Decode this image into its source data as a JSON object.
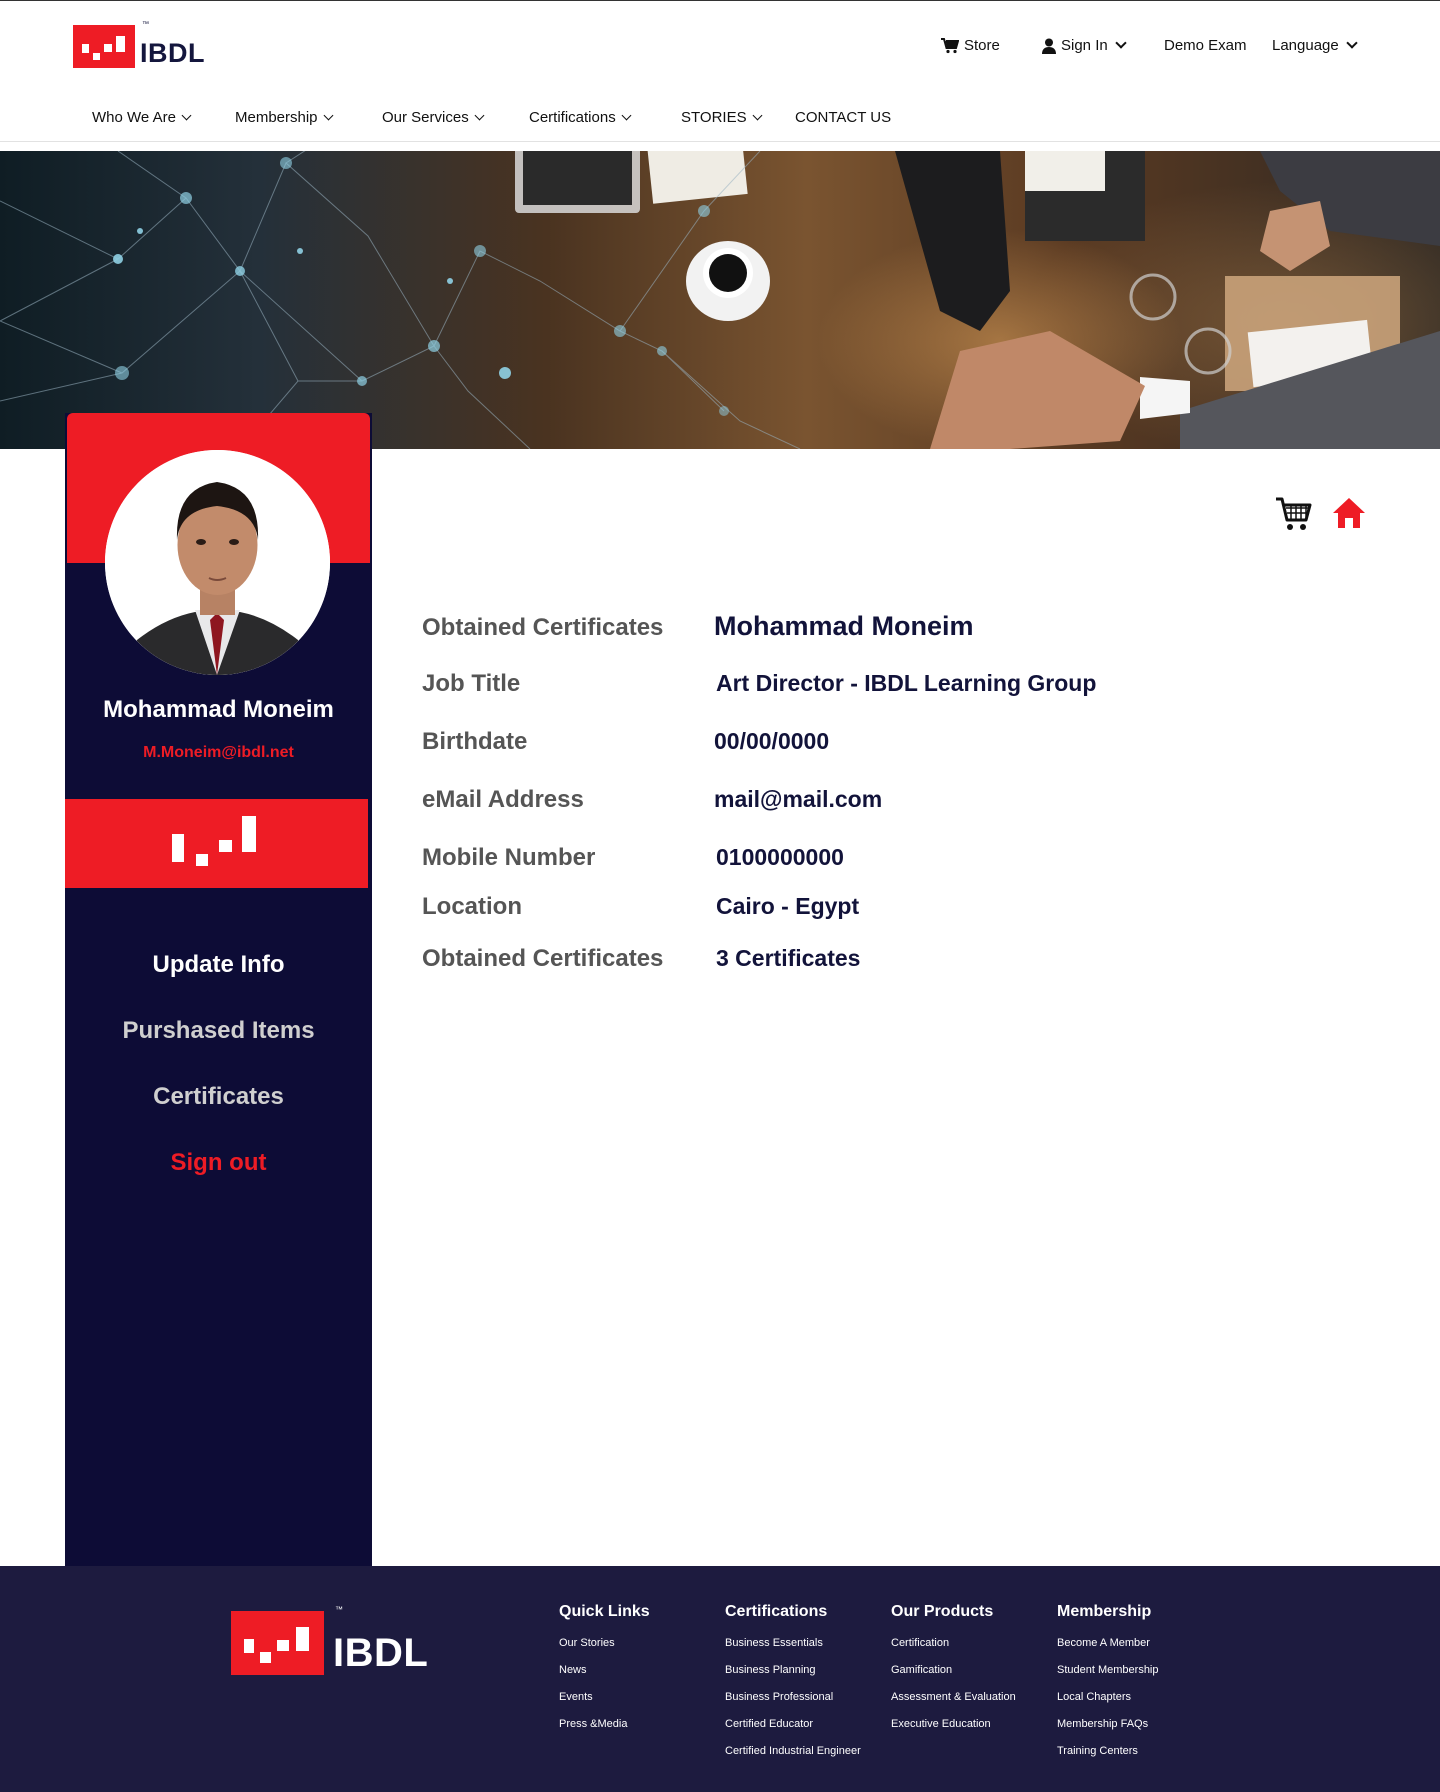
{
  "brand": {
    "name": "IBDL",
    "tm": "™",
    "color": "#ee1c25",
    "navy": "#0d0c36"
  },
  "utility_nav": [
    {
      "label": "Store",
      "icon": "cart-icon"
    },
    {
      "label": "Sign In",
      "icon": "user-icon",
      "dropdown": true
    },
    {
      "label": "Demo Exam"
    },
    {
      "label": "Language",
      "dropdown": true
    }
  ],
  "main_nav": [
    {
      "label": "Who We Are",
      "dropdown": true
    },
    {
      "label": "Membership",
      "dropdown": true
    },
    {
      "label": "Our Services",
      "dropdown": true
    },
    {
      "label": "Certifications",
      "dropdown": true
    },
    {
      "label": "STORIES",
      "dropdown": true
    },
    {
      "label": "CONTACT US"
    }
  ],
  "user": {
    "name": "Mohammad Moneim",
    "email": "M.Moneim@ibdl.net"
  },
  "sidebar_menu": [
    {
      "label": "Update Info",
      "color": "#ffffff"
    },
    {
      "label": "Purshased Items",
      "color": "#cfcfcf"
    },
    {
      "label": "Certificates",
      "color": "#cfcfcf"
    },
    {
      "label": "Sign out",
      "color": "#ee1c25"
    }
  ],
  "profile": [
    {
      "label": "Obtained Certificates",
      "value": "Mohammad Moneim"
    },
    {
      "label": "Job Title",
      "value": "Art Director - IBDL Learning Group"
    },
    {
      "label": "Birthdate",
      "value": "00/00/0000"
    },
    {
      "label": "eMail Address",
      "value": "mail@mail.com"
    },
    {
      "label": "Mobile Number",
      "value": "0100000000"
    },
    {
      "label": "Location",
      "value": "Cairo - Egypt"
    },
    {
      "label": "Obtained Certificates",
      "value": "3 Certificates"
    }
  ],
  "footer": {
    "columns": [
      {
        "title": "Quick Links",
        "links": [
          "Our Stories",
          "News",
          "Events",
          "Press &Media"
        ]
      },
      {
        "title": "Certifications",
        "links": [
          "Business Essentials",
          "Business Planning",
          "Business Professional",
          "Certified Educator",
          "Certified Industrial Engineer"
        ]
      },
      {
        "title": "Our Products",
        "links": [
          "Certification",
          "Gamification",
          "Assessment & Evaluation",
          "Executive Education"
        ]
      },
      {
        "title": "Membership",
        "links": [
          "Become A Member",
          "Student Membership",
          "Local Chapters",
          "Membership FAQs",
          "Training Centers"
        ]
      }
    ]
  }
}
